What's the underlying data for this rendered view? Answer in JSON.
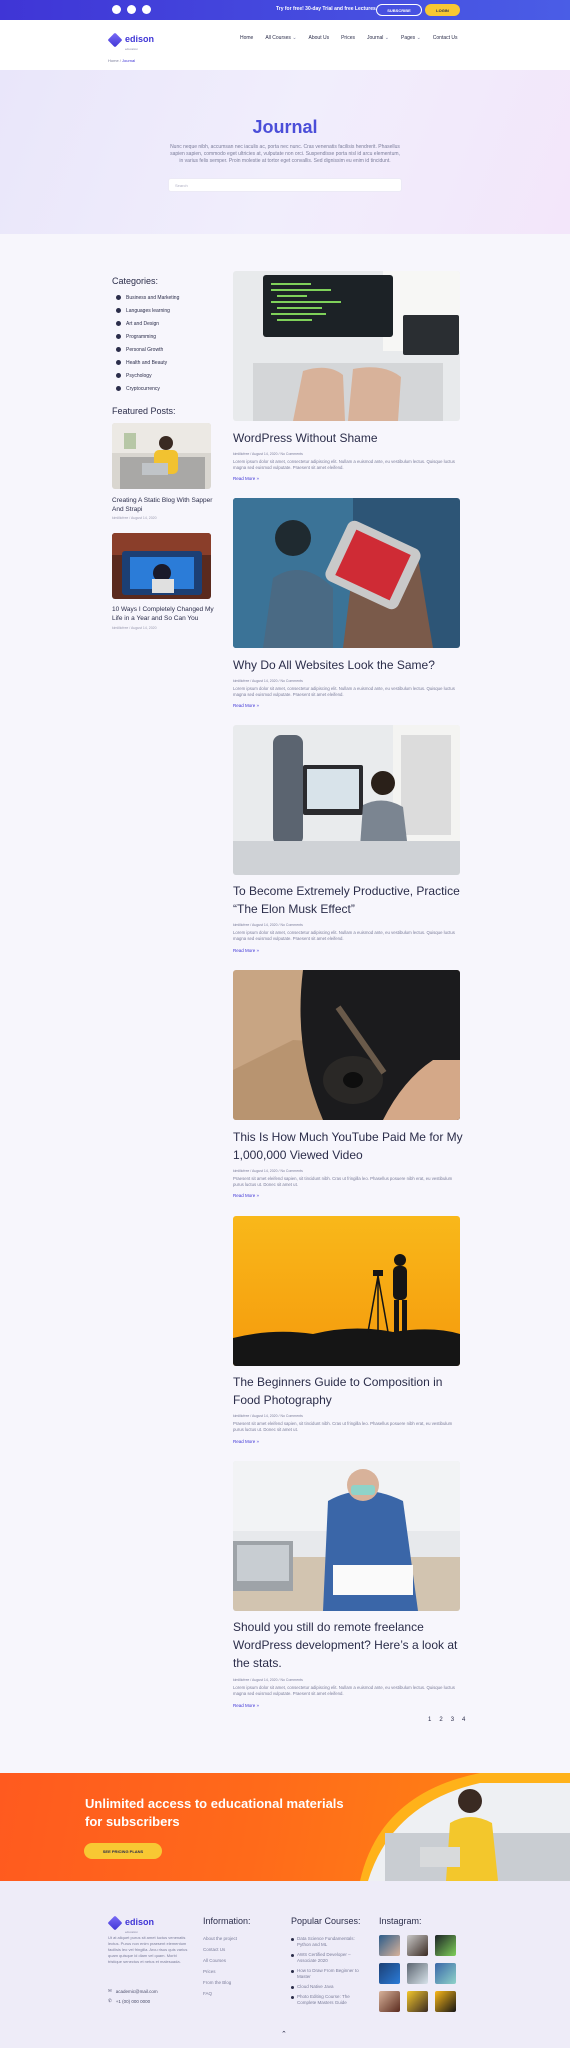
{
  "topbar": {
    "promo": "Try for free! 30-day Trial and free Lectures",
    "subscribe": "SUBSCRIBE",
    "login": "LOGIN",
    "social_icons": [
      "facebook-icon",
      "youtube-icon",
      "instagram-icon"
    ]
  },
  "header": {
    "logo_name": "edison",
    "logo_tag": "education",
    "nav": [
      {
        "label": "Home"
      },
      {
        "label": "All Courses",
        "caret": "⌄"
      },
      {
        "label": "About Us"
      },
      {
        "label": "Prices"
      },
      {
        "label": "Journal",
        "caret": "⌄"
      },
      {
        "label": "Pages",
        "caret": "⌄"
      },
      {
        "label": "Contact Us"
      }
    ],
    "breadcrumb_home": "Home",
    "breadcrumb_sep": " / ",
    "breadcrumb_current": "Journal"
  },
  "hero": {
    "title": "Journal",
    "description": "Nunc neque nibh, accumsan nec iaculis ac, porta nec nunc. Cras venenatis facilisis hendrerit. Phasellus sapien sapien, commodo eget ultricies at, vulputate non orci. Suspendisse porta nisl id arcu elementum, in varius felis semper. Proin molestie at tortor eget convallis. Sed dignissim eu enim id tincidunt.",
    "search_placeholder": "Search"
  },
  "sidebar": {
    "categories_title": "Categories:",
    "categories": [
      "Business and Marketing",
      "Languages learning",
      "Art and Design",
      "Programming",
      "Personal Growth",
      "Health and Beauty",
      "Psychology",
      "Cryptocurrency"
    ],
    "featured_title": "Featured Posts:",
    "featured": [
      {
        "title": "Creating A Static Blog With Sapper And Strapi",
        "meta": "kimlilicfree / August 14, 2020"
      },
      {
        "title": "10 Ways I Completely Changed My Life in a Year and So Can You",
        "meta": "kimlilicfree / August 14, 2020"
      }
    ]
  },
  "posts": [
    {
      "title": "WordPress Without Shame",
      "meta": "kimlilicfree / August 14, 2020 / No Comments",
      "excerpt": "Lorem ipsum dolor sit amet, consectetur adipiscing elit. Nullam a euismod ante, eu vestibulum lectus. Quisque luctus magna sed euismod vulputate. Praesent sit amet eleifend.",
      "read_more": "Read More »"
    },
    {
      "title": "Why Do All Websites Look the Same?",
      "meta": "kimlilicfree / August 14, 2020 / No Comments",
      "excerpt": "Lorem ipsum dolor sit amet, consectetur adipiscing elit. Nullam a euismod ante, eu vestibulum lectus. Quisque luctus magna sed euismod vulputate. Praesent sit amet eleifend.",
      "read_more": "Read More »"
    },
    {
      "title": "To Become Extremely Productive, Practice “The Elon Musk Effect”",
      "meta": "kimlilicfree / August 14, 2020 / No Comments",
      "excerpt": "Lorem ipsum dolor sit amet, consectetur adipiscing elit. Nullam a euismod ante, eu vestibulum lectus. Quisque luctus magna sed euismod vulputate. Praesent sit amet eleifend.",
      "read_more": "Read More »"
    },
    {
      "title": "This Is How Much YouTube Paid Me for My 1,000,000 Viewed Video",
      "meta": "kimlilicfree / August 14, 2020 / No Comments",
      "excerpt": "Praesent sit amet eleifend sapien, sit tincidunt nibh. Cras ut fringilla leo. Phasellus posuere nibh erat, eu vestibulum purus luctus ut. Donec sit amet ut.",
      "read_more": "Read More »"
    },
    {
      "title": "The Beginners Guide to Composition in Food Photography",
      "meta": "kimlilicfree / August 14, 2020 / No Comments",
      "excerpt": "Praesent sit amet eleifend sapien, sit tincidunt nibh. Cras ut fringilla leo. Phasellus posuere nibh erat, eu vestibulum purus luctus ut. Donec sit amet ut.",
      "read_more": "Read More »"
    },
    {
      "title": "Should you still do remote freelance WordPress development? Here’s a look at the stats.",
      "meta": "kimlilicfree / August 14, 2020 / No Comments",
      "excerpt": "Lorem ipsum dolor sit amet, consectetur adipiscing elit. Nullam a euismod ante, eu vestibulum lectus. Quisque luctus magna sed euismod vulputate. Praesent sit amet eleifend.",
      "read_more": "Read More »"
    }
  ],
  "pagination": [
    "1",
    "2",
    "3",
    "4"
  ],
  "cta": {
    "title": "Unlimited access to educational materials for subscribers",
    "button": "SEE PRICING PLANS"
  },
  "footer": {
    "logo_name": "edison",
    "logo_tag": "education",
    "description": "Ut at aliquet purus sit amet luctus venenatis lectus. Purus non enim praesent elementum facilisis leo vel fringilla. Arcu risus quis varius quam quisque id diam vel quam. Morbi tristique senectus et netus et malesuada.",
    "email": "academic@mail.com",
    "phone": "+1 (00) 000 0000",
    "info_title": "Information:",
    "info_links": [
      "About the project",
      "Contact Us",
      "All Courses",
      "Prices",
      "From the Blog",
      "FAQ"
    ],
    "courses_title": "Popular Courses:",
    "courses": [
      "Data Science Fundamentals: Python and ML",
      "AWS Certified Developer – Associate 2020",
      "How to Draw From Beginner to Master",
      "Cloud Native Java",
      "Photo Editing Course: The Complete Masters Guide"
    ],
    "instagram_title": "Instagram:",
    "scroll_top": "⌃"
  },
  "colors": {
    "accent": "#3f35d6",
    "cta": "#ff6a1a",
    "yellow": "#f8c833"
  }
}
